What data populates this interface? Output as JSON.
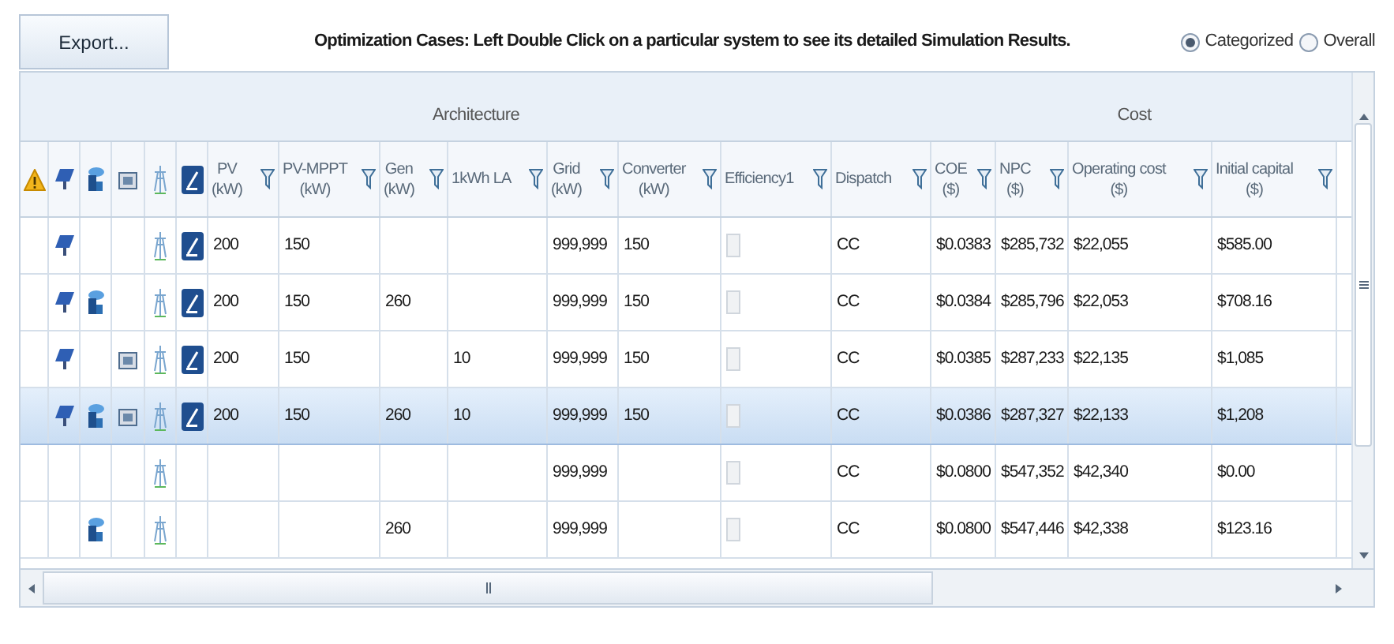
{
  "toolbar": {
    "export_button": "Export...",
    "instruction": "Optimization Cases: Left Double Click on a particular system to see its detailed Simulation Results.",
    "view_options": [
      {
        "label": "Categorized",
        "selected": true
      },
      {
        "label": "Overall",
        "selected": false
      }
    ]
  },
  "column_groups": [
    {
      "label": "Architecture",
      "columns": [
        {
          "label": "PV",
          "unit": "(kW)"
        },
        {
          "label": "PV-MPPT",
          "unit": "(kW)"
        },
        {
          "label": "Gen",
          "unit": "(kW)"
        },
        {
          "label": "1kWh LA"
        },
        {
          "label": "Grid",
          "unit": "(kW)"
        },
        {
          "label": "Converter",
          "unit": "(kW)"
        },
        {
          "label": "Efficiency1",
          "kind": "checkbox"
        },
        {
          "label": "Dispatch"
        }
      ]
    },
    {
      "label": "Cost",
      "columns": [
        {
          "label": "COE",
          "unit": "($)"
        },
        {
          "label": "NPC",
          "unit": "($)"
        },
        {
          "label": "Operating cost",
          "unit": "($)"
        },
        {
          "label": "Initial capital",
          "unit": "($)"
        }
      ]
    }
  ],
  "rows": [
    {
      "selected": false,
      "pv": true,
      "generator": false,
      "battery": false,
      "grid": true,
      "converter": true,
      "efficiency_checked": false,
      "cells": [
        "200",
        "150",
        null,
        null,
        "999,999",
        "150",
        "CC",
        "$0.0383",
        "$285,732",
        "$22,055",
        "$585.00"
      ]
    },
    {
      "selected": false,
      "pv": true,
      "generator": true,
      "battery": false,
      "grid": true,
      "converter": true,
      "efficiency_checked": false,
      "cells": [
        "200",
        "150",
        "260",
        null,
        "999,999",
        "150",
        "CC",
        "$0.0384",
        "$285,796",
        "$22,053",
        "$708.16"
      ]
    },
    {
      "selected": false,
      "pv": true,
      "generator": false,
      "battery": true,
      "grid": true,
      "converter": true,
      "efficiency_checked": false,
      "cells": [
        "200",
        "150",
        null,
        "10",
        "999,999",
        "150",
        "CC",
        "$0.0385",
        "$287,233",
        "$22,135",
        "$1,085"
      ]
    },
    {
      "selected": true,
      "pv": true,
      "generator": true,
      "battery": true,
      "grid": true,
      "converter": true,
      "efficiency_checked": false,
      "cells": [
        "200",
        "150",
        "260",
        "10",
        "999,999",
        "150",
        "CC",
        "$0.0386",
        "$287,327",
        "$22,133",
        "$1,208"
      ]
    },
    {
      "selected": false,
      "pv": false,
      "generator": false,
      "battery": false,
      "grid": true,
      "converter": false,
      "efficiency_checked": false,
      "cells": [
        null,
        null,
        null,
        null,
        "999,999",
        null,
        "CC",
        "$0.0800",
        "$547,352",
        "$42,340",
        "$0.00"
      ]
    },
    {
      "selected": false,
      "pv": false,
      "generator": true,
      "battery": false,
      "grid": true,
      "converter": false,
      "efficiency_checked": false,
      "cells": [
        null,
        null,
        "260",
        null,
        "999,999",
        null,
        "CC",
        "$0.0800",
        "$547,446",
        "$42,338",
        "$123.16"
      ]
    }
  ]
}
